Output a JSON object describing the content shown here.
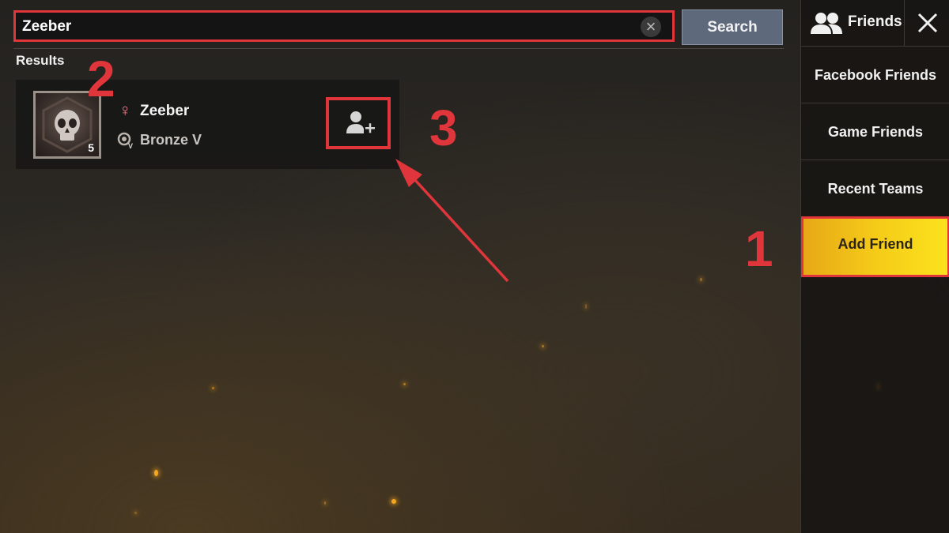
{
  "search": {
    "value": "Zeeber",
    "clear_icon": "close-icon",
    "button_label": "Search"
  },
  "results": {
    "label": "Results",
    "items": [
      {
        "level": "5",
        "name": "Zeeber",
        "gender_icon": "female-icon",
        "rank": "Bronze V",
        "rank_icon": "bronze-rank-icon",
        "action_icon": "add-user-icon"
      }
    ]
  },
  "side_panel": {
    "header_label": "Friends",
    "header_icon": "friends-icon",
    "close_icon": "close-icon",
    "items": [
      {
        "label": "Facebook Friends",
        "active": false
      },
      {
        "label": "Game Friends",
        "active": false
      },
      {
        "label": "Recent Teams",
        "active": false
      },
      {
        "label": "Add Friend",
        "active": true
      }
    ]
  },
  "annotations": {
    "step1": "1",
    "step2": "2",
    "step3": "3"
  },
  "colors": {
    "annotation_red": "#e0353b",
    "active_tab_yellow": "#f5cb18",
    "search_button": "#5e6a7c"
  }
}
